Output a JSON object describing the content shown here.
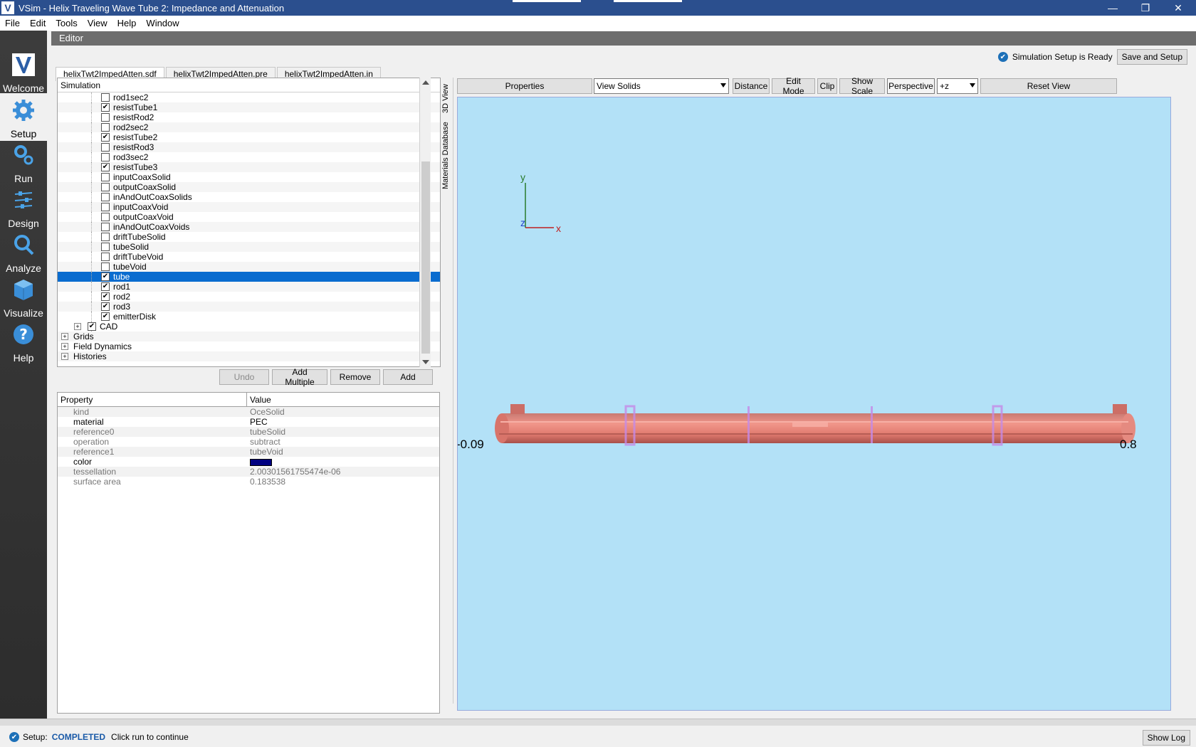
{
  "window": {
    "app_logo": "V",
    "title": "VSim - Helix Traveling Wave Tube 2: Impedance and Attenuation",
    "minimize": "—",
    "restore": "❐",
    "close": "✕"
  },
  "menu": [
    "File",
    "Edit",
    "Tools",
    "View",
    "Help",
    "Window"
  ],
  "nav": [
    {
      "label": "Welcome",
      "icon": "vsim-logo-icon"
    },
    {
      "label": "Setup",
      "icon": "gear-icon",
      "active": true
    },
    {
      "label": "Run",
      "icon": "gears-icon"
    },
    {
      "label": "Design",
      "icon": "sliders-icon"
    },
    {
      "label": "Analyze",
      "icon": "magnifier-icon"
    },
    {
      "label": "Visualize",
      "icon": "cube-icon"
    },
    {
      "label": "Help",
      "icon": "question-icon"
    }
  ],
  "editor": {
    "header": "Editor",
    "status_text": "Simulation Setup is Ready",
    "save_setup": "Save and Setup",
    "files": [
      "helixTwt2ImpedAtten.sdf",
      "helixTwt2ImpedAtten.pre",
      "helixTwt2ImpedAtten.in"
    ]
  },
  "tree": {
    "header": "Simulation",
    "items": [
      {
        "label": "rod1sec2",
        "checked": false
      },
      {
        "label": "resistTube1",
        "checked": true
      },
      {
        "label": "resistRod2",
        "checked": false
      },
      {
        "label": "rod2sec2",
        "checked": false
      },
      {
        "label": "resistTube2",
        "checked": true
      },
      {
        "label": "resistRod3",
        "checked": false
      },
      {
        "label": "rod3sec2",
        "checked": false
      },
      {
        "label": "resistTube3",
        "checked": true
      },
      {
        "label": "inputCoaxSolid",
        "checked": false
      },
      {
        "label": "outputCoaxSolid",
        "checked": false
      },
      {
        "label": "inAndOutCoaxSolids",
        "checked": false
      },
      {
        "label": "inputCoaxVoid",
        "checked": false
      },
      {
        "label": "outputCoaxVoid",
        "checked": false
      },
      {
        "label": "inAndOutCoaxVoids",
        "checked": false
      },
      {
        "label": "driftTubeSolid",
        "checked": false
      },
      {
        "label": "tubeSolid",
        "checked": false
      },
      {
        "label": "driftTubeVoid",
        "checked": false
      },
      {
        "label": "tubeVoid",
        "checked": false
      },
      {
        "label": "tube",
        "checked": true,
        "selected": true
      },
      {
        "label": "rod1",
        "checked": true
      },
      {
        "label": "rod2",
        "checked": true
      },
      {
        "label": "rod3",
        "checked": true
      },
      {
        "label": "emitterDisk",
        "checked": true
      }
    ],
    "cad_label": "CAD",
    "groups": [
      "Grids",
      "Field Dynamics",
      "Histories"
    ]
  },
  "tree_buttons": {
    "undo": "Undo",
    "add_multiple": "Add Multiple",
    "remove": "Remove",
    "add": "Add"
  },
  "properties": {
    "col_property": "Property",
    "col_value": "Value",
    "rows": [
      {
        "key": "kind",
        "value": "OceSolid",
        "bold": false
      },
      {
        "key": "material",
        "value": "PEC",
        "bold": true
      },
      {
        "key": "reference0",
        "value": "tubeSolid",
        "bold": false
      },
      {
        "key": "operation",
        "value": "subtract",
        "bold": false
      },
      {
        "key": "reference1",
        "value": "tubeVoid",
        "bold": false
      },
      {
        "key": "color",
        "value": "",
        "bold": true,
        "swatch": "#000080"
      },
      {
        "key": "tessellation",
        "value": "2.00301561755474e-06",
        "bold": false
      },
      {
        "key": "surface area",
        "value": "0.183538",
        "bold": false
      }
    ]
  },
  "view": {
    "side_tabs": [
      "3D View",
      "Materials Database"
    ],
    "properties_btn": "Properties",
    "view_mode": "View Solids",
    "distance": "Distance",
    "edit_mode": "Edit Mode",
    "clip": "Clip",
    "show_scale": "Show Scale",
    "perspective": "Perspective",
    "orientation": "+z",
    "reset_view": "Reset View",
    "axis_y": "y",
    "axis_z": "z",
    "axis_x": "x",
    "scale_min": "-0.09",
    "scale_max": "0.8",
    "background": "#b3e1f7"
  },
  "status": {
    "prefix": "Setup:",
    "state": "COMPLETED",
    "message": "Click run to continue",
    "show_log": "Show Log"
  }
}
